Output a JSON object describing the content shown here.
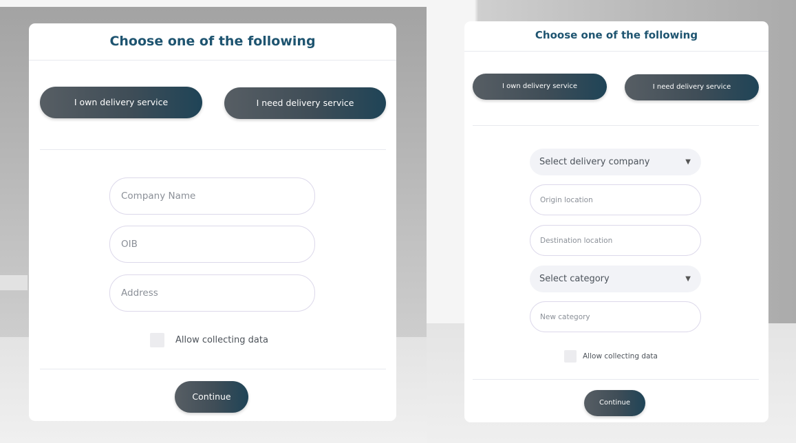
{
  "left_form": {
    "title": "Choose one of the following",
    "own_delivery_label": "I own delivery service",
    "need_delivery_label": "I need delivery service",
    "company_name_placeholder": "Company Name",
    "oib_placeholder": "OIB",
    "address_placeholder": "Address",
    "allow_data_label": "Allow collecting data",
    "continue_label": "Continue"
  },
  "right_form": {
    "title": "Choose one of the following",
    "own_delivery_label": "I own delivery service",
    "need_delivery_label": "I need delivery service",
    "delivery_company_select": "Select delivery company",
    "origin_placeholder": "Origin location",
    "destination_placeholder": "Destination location",
    "category_select": "Select category",
    "new_category_placeholder": "New category",
    "allow_data_label": "Allow collecting data",
    "continue_label": "Continue"
  },
  "icons": {
    "select_chevron": "chevron-down-icon"
  },
  "colors": {
    "title": "#1e5470",
    "button_gradient_start": "#575e64",
    "button_gradient_end": "#1f4457",
    "card_background": "#ffffff"
  }
}
